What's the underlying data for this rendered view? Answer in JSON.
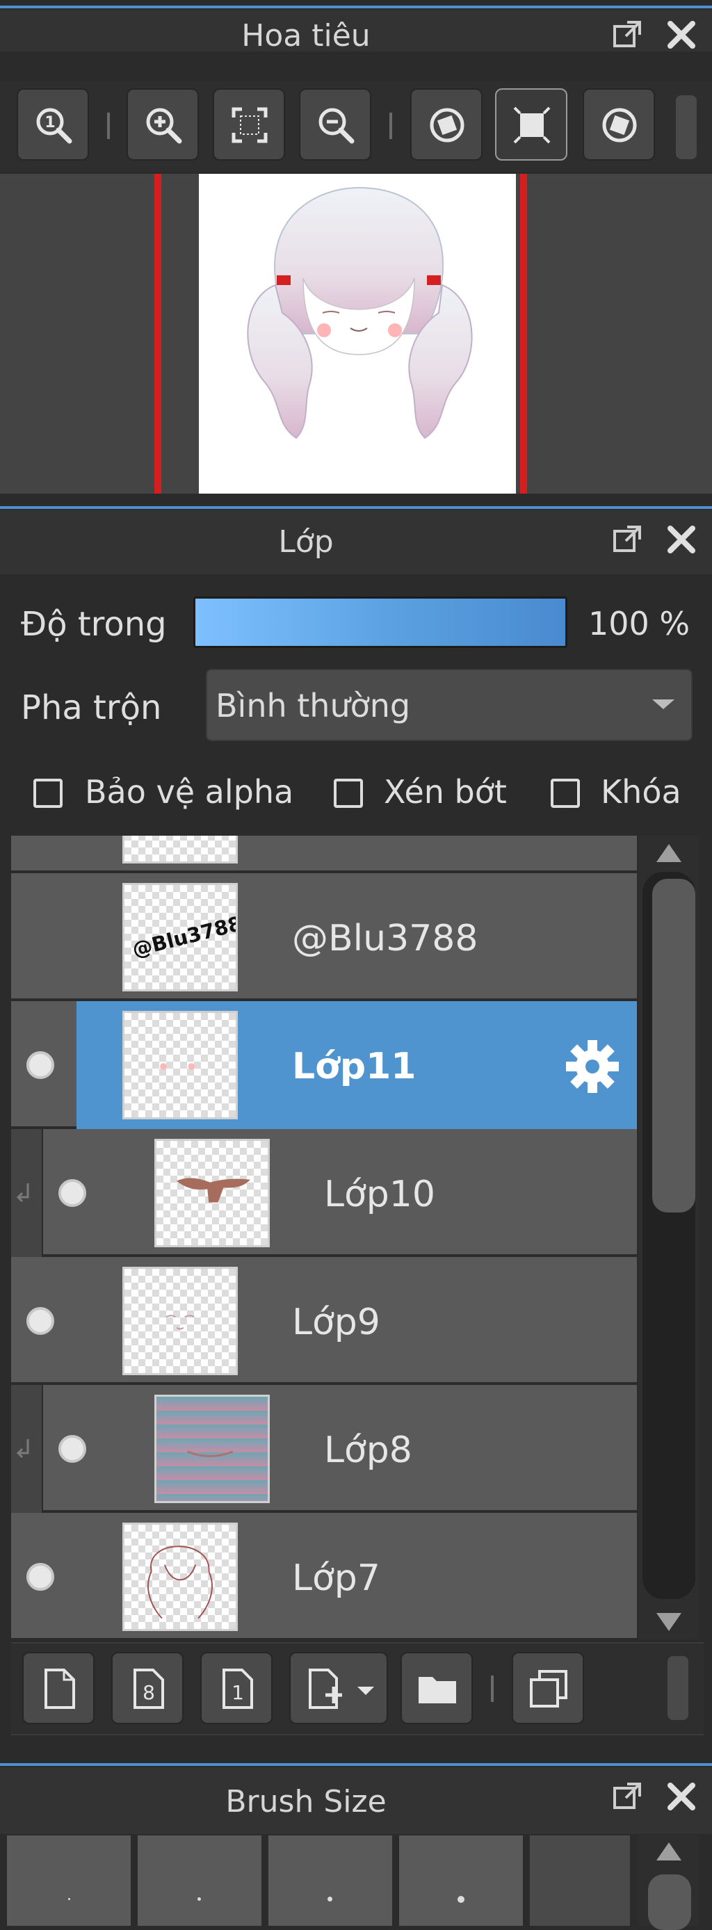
{
  "navigator": {
    "title": "Hoa tiêu",
    "tools": [
      {
        "icon": "zoom-actual-icon"
      },
      {
        "icon": "zoom-in-icon"
      },
      {
        "icon": "fit-screen-icon"
      },
      {
        "icon": "zoom-out-icon"
      },
      {
        "icon": "rotate-left-icon"
      },
      {
        "icon": "flip-frame-icon"
      },
      {
        "icon": "rotate-right-icon"
      }
    ]
  },
  "layers_panel": {
    "title": "Lớp",
    "opacity_label": "Độ trong",
    "opacity_value": "100 %",
    "blend_label": "Pha trộn",
    "blend_value": "Bình thường",
    "protect_alpha_label": "Bảo vệ alpha",
    "clipping_label": "Xén bớt",
    "lock_label": "Khóa",
    "layers": [
      {
        "name": "",
        "visible": false,
        "selected": false,
        "clipped": false,
        "partial": true
      },
      {
        "name": "@Blu3788",
        "visible": false,
        "selected": false,
        "clipped": false,
        "thumb_text": "@Blu3788"
      },
      {
        "name": "Lớp11",
        "visible": true,
        "selected": true,
        "clipped": false
      },
      {
        "name": "Lớp10",
        "visible": true,
        "selected": false,
        "clipped": true
      },
      {
        "name": "Lớp9",
        "visible": true,
        "selected": false,
        "clipped": false
      },
      {
        "name": "Lớp8",
        "visible": true,
        "selected": false,
        "clipped": true
      },
      {
        "name": "Lớp7",
        "visible": true,
        "selected": false,
        "clipped": false
      }
    ],
    "bottom_tools": [
      {
        "icon": "new-layer-icon"
      },
      {
        "icon": "new-8bit-layer-icon"
      },
      {
        "icon": "new-1bit-layer-icon"
      },
      {
        "icon": "add-layer-menu-icon"
      },
      {
        "icon": "folder-icon"
      },
      {
        "icon": "duplicate-layer-icon"
      }
    ]
  },
  "brush_size": {
    "title": "Brush Size"
  },
  "colors": {
    "accent": "#4f93cf",
    "panel_bg": "#2b2b2b",
    "row_bg": "#5a5a5a",
    "guide_red": "#d61e1e"
  }
}
